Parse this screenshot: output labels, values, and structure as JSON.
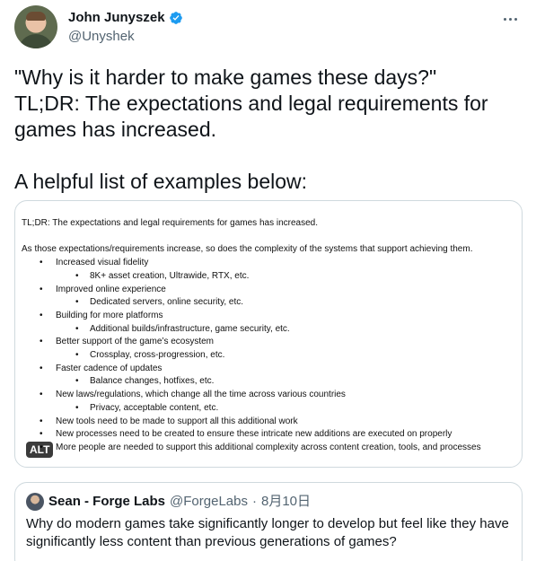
{
  "author": {
    "display_name": "John Junyszek",
    "handle": "@Unyshek",
    "avatar_icon": "avatar-photo",
    "verified_icon": "verified-badge-icon",
    "verified_color": "#1d9bf0"
  },
  "tweet": {
    "text": "\"Why is it harder to make games these days?\"\nTL;DR: The expectations and legal requirements for games has increased.\n\nA helpful list of examples below:"
  },
  "image": {
    "alt_badge": "ALT",
    "line1": "TL;DR: The expectations and legal requirements for games has increased.",
    "line2": "As those expectations/requirements increase, so does the complexity of the systems that support achieving them.",
    "items": [
      {
        "level": 1,
        "text": "Increased visual fidelity"
      },
      {
        "level": 2,
        "text": "8K+ asset creation, Ultrawide, RTX, etc."
      },
      {
        "level": 1,
        "text": "Improved online experience"
      },
      {
        "level": 2,
        "text": "Dedicated servers, online security, etc."
      },
      {
        "level": 1,
        "text": "Building for more platforms"
      },
      {
        "level": 2,
        "text": "Additional builds/infrastructure, game security, etc."
      },
      {
        "level": 1,
        "text": "Better support of the game’s ecosystem"
      },
      {
        "level": 2,
        "text": "Crossplay, cross-progression, etc."
      },
      {
        "level": 1,
        "text": "Faster cadence of updates"
      },
      {
        "level": 2,
        "text": "Balance changes, hotfixes, etc."
      },
      {
        "level": 1,
        "text": "New laws/regulations, which change all the time across various countries"
      },
      {
        "level": 2,
        "text": "Privacy, acceptable content, etc."
      },
      {
        "level": 1,
        "text": "New tools need to be made to support all this additional work"
      },
      {
        "level": 1,
        "text": "New processes need to be created to ensure these intricate new additions are executed on properly"
      },
      {
        "level": 1,
        "text": "More people are needed to support this additional complexity across content creation, tools, and processes"
      }
    ]
  },
  "quote": {
    "display_name": "Sean - Forge Labs",
    "handle": "@ForgeLabs",
    "separator": "·",
    "date": "8月10日",
    "text": "Why do modern games take significantly longer to develop but feel like they have significantly less content than previous generations of games?"
  },
  "colors": {
    "text": "#0f1419",
    "secondary": "#536471",
    "border": "#cfd9de"
  }
}
